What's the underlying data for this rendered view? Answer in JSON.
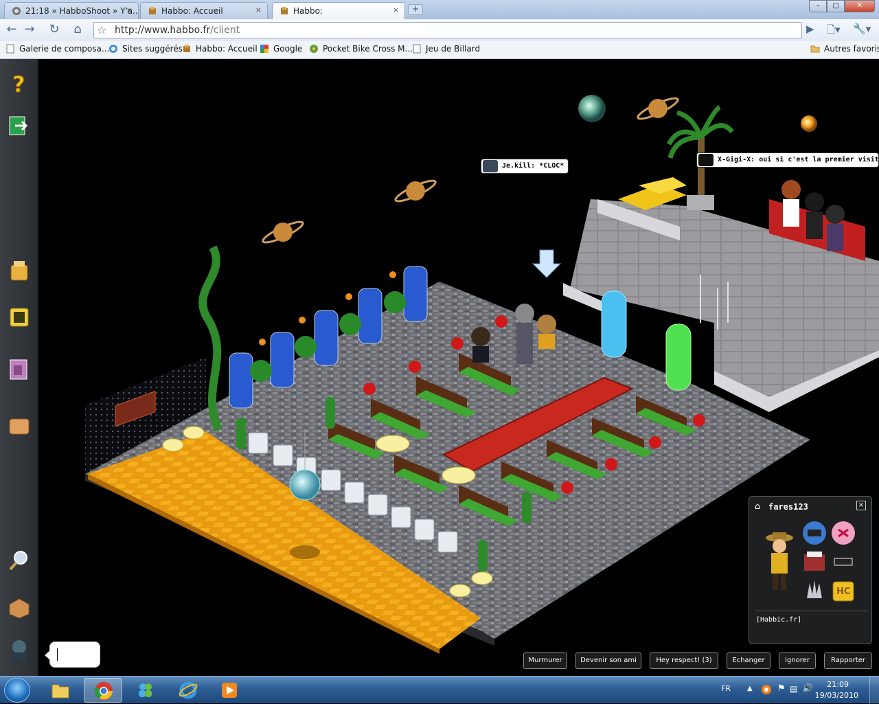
{
  "browser": {
    "tabs": [
      {
        "label": "21:18 » HabboShoot » Y'a..."
      },
      {
        "label": "Habbo: Accueil"
      },
      {
        "label": "Habbo:"
      }
    ],
    "tab_close": "×",
    "new_tab": "+",
    "window_buttons": {
      "minimize": "–",
      "maximize": "□",
      "close": "✕"
    },
    "url_host": "http://www.habbo.fr",
    "url_path": "/client",
    "bookmarks": [
      {
        "label": "Galerie de composa..."
      },
      {
        "label": "Sites suggérés"
      },
      {
        "label": "Habbo: Accueil"
      },
      {
        "label": "Google"
      },
      {
        "label": "Pocket Bike Cross M..."
      },
      {
        "label": "Jeu de Billard"
      }
    ],
    "other_bookmarks": "Autres favoris"
  },
  "room": {
    "chat": [
      {
        "user": "Je.kill:",
        "text": "*CLOC*"
      },
      {
        "user": "X-Gigi-X:",
        "text": "oui si c'est la premier visite ..."
      }
    ],
    "floor_color": "#f0a010",
    "rug_color": "#c8281e",
    "sofa_color": "#3ea832"
  },
  "sidebar": {
    "icons": [
      "help-icon",
      "exit-room-icon",
      "catalog-icon",
      "navigator-icon",
      "gallery-icon",
      "inventory-icon",
      "search-icon",
      "room-icon",
      "avatar-icon"
    ]
  },
  "infopanel": {
    "username": "fares123",
    "motto": "[Habbic.fr]",
    "close": "×"
  },
  "actions": {
    "whisper": "Murmurer",
    "friend": "Devenir son ami",
    "respect": "Hey respect! (3)",
    "trade": "Echanger",
    "ignore": "Ignorer",
    "report": "Rapporter"
  },
  "taskbar": {
    "lang": "FR",
    "time": "21:09",
    "date": "19/03/2010"
  }
}
